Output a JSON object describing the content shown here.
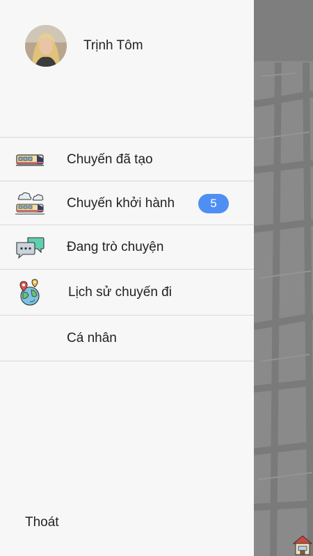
{
  "user": {
    "name": "Trịnh Tôm",
    "avatar_icon": "user-avatar"
  },
  "menu": [
    {
      "label": "Chuyến đã tạo",
      "icon": "train-icon",
      "badge": null
    },
    {
      "label": "Chuyến khởi hành",
      "icon": "train-clouds-icon",
      "badge": "5"
    },
    {
      "label": "Đang trò chuyện",
      "icon": "chat-bubbles-icon",
      "badge": null
    },
    {
      "label": "Lịch sử chuyến đi",
      "icon": "globe-pins-icon",
      "badge": null
    },
    {
      "label": "Cá nhân",
      "icon": "",
      "badge": null
    }
  ],
  "logout_label": "Thoát",
  "colors": {
    "drawer_bg": "#f7f7f7",
    "badge_bg": "#4f8ff3",
    "map_bg": "#8a8a8a"
  }
}
